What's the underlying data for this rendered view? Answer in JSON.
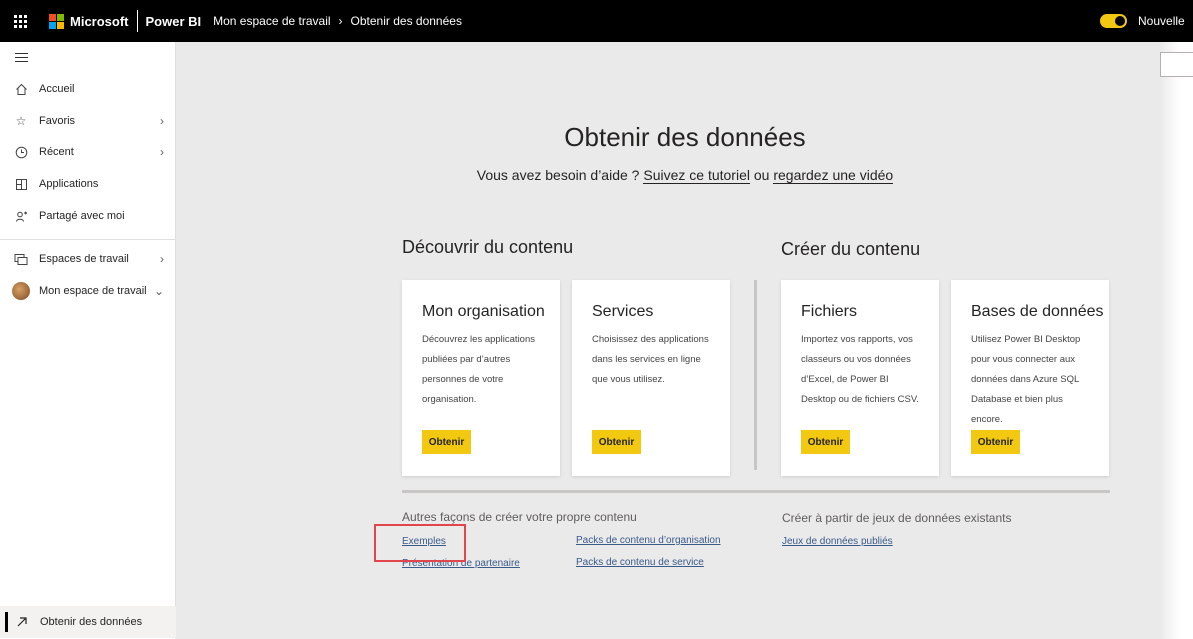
{
  "topbar": {
    "brand": "Microsoft",
    "app": "Power BI",
    "breadcrumb": [
      "Mon espace de travail",
      "Obtenir des données"
    ],
    "new_look_label": "Nouvelle"
  },
  "sidebar": {
    "items": [
      {
        "label": "Accueil",
        "icon": "home-icon"
      },
      {
        "label": "Favoris",
        "icon": "star-icon"
      },
      {
        "label": "Récent",
        "icon": "clock-icon"
      },
      {
        "label": "Applications",
        "icon": "apps-icon"
      },
      {
        "label": "Partagé avec moi",
        "icon": "shared-icon"
      },
      {
        "label": "Espaces de travail",
        "icon": "workspaces-icon"
      },
      {
        "label": "Mon espace de travail",
        "icon": "avatar"
      }
    ],
    "bottom_item": {
      "label": "Obtenir des données",
      "icon": "arrow-up-right-icon"
    }
  },
  "main": {
    "title": "Obtenir des données",
    "help": {
      "prefix": "Vous avez besoin d’aide ?",
      "link1": "Suivez ce tutoriel",
      "middle": "ou",
      "link2": "regardez une vidéo"
    },
    "discover_heading": "Découvrir du contenu",
    "create_heading": "Créer du contenu",
    "cards": [
      {
        "title": "Mon organisation",
        "desc": "Découvrez les applications publiées par d’autres personnes de votre organisation.",
        "button": "Obtenir"
      },
      {
        "title": "Services",
        "desc": "Choisissez des applications dans les services en ligne que vous utilisez.",
        "button": "Obtenir"
      },
      {
        "title": "Fichiers",
        "desc": "Importez vos rapports, vos classeurs ou vos données d’Excel, de Power BI Desktop ou de fichiers CSV.",
        "button": "Obtenir"
      },
      {
        "title": "Bases de données",
        "desc": "Utilisez Power BI Desktop pour vous connecter aux données dans Azure SQL Database et bien plus encore.",
        "button": "Obtenir"
      }
    ],
    "other_heading": "Autres façons de créer votre propre contenu",
    "other_links": [
      "Exemples",
      "Présentation de partenaire",
      "Packs de contenu d’organisation",
      "Packs de contenu de service"
    ],
    "existing_heading": "Créer à partir de jeux de données existants",
    "existing_links": [
      "Jeux de données publiés"
    ]
  },
  "colors": {
    "accent": "#f2c811",
    "highlight": "#e0464c",
    "link": "#3a5a8a"
  }
}
